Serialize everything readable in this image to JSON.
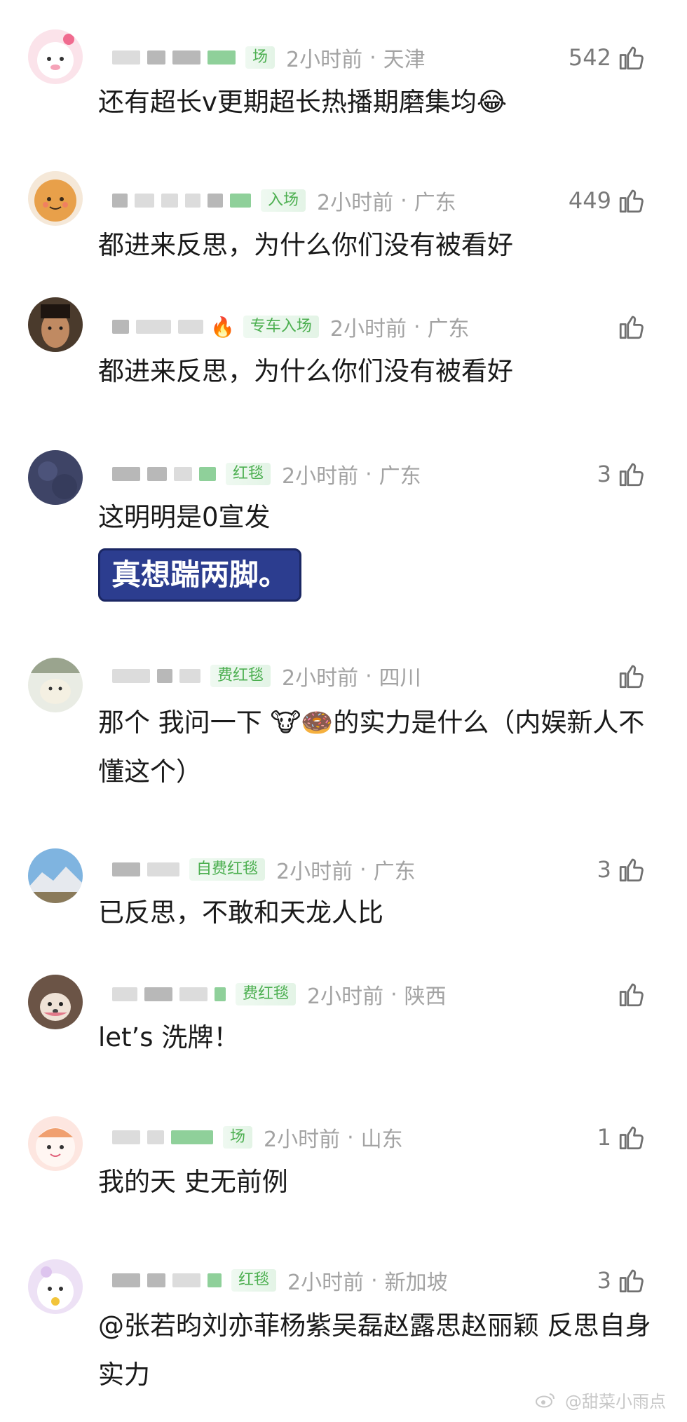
{
  "comments": [
    {
      "badge": "场",
      "time": "2小时前",
      "location": "天津",
      "likes": "542",
      "text": "还有超长v更期超长热播期磨集均😂"
    },
    {
      "badge": "入场",
      "time": "2小时前",
      "location": "广东",
      "likes": "449",
      "text": "都进来反思，为什么你们没有被看好"
    },
    {
      "badge": "专车入场",
      "time": "2小时前",
      "location": "广东",
      "likes": "",
      "text": "都进来反思，为什么你们没有被看好"
    },
    {
      "badge": "红毯",
      "time": "2小时前",
      "location": "广东",
      "likes": "3",
      "text": "这明明是0宣发",
      "sticker": "真想踹两脚。"
    },
    {
      "badge": "费红毯",
      "time": "2小时前",
      "location": "四川",
      "likes": "",
      "text": "那个 我问一下 🐮🍩的实力是什么（内娱新人不懂这个）"
    },
    {
      "badge": "自费红毯",
      "time": "2小时前",
      "location": "广东",
      "likes": "3",
      "text": "已反思，不敢和天龙人比"
    },
    {
      "badge": "费红毯",
      "time": "2小时前",
      "location": "陕西",
      "likes": "",
      "text": "let’s 洗牌！"
    },
    {
      "badge": "场",
      "time": "2小时前",
      "location": "山东",
      "likes": "1",
      "text": "我的天 史无前例"
    },
    {
      "badge": "红毯",
      "time": "2小时前",
      "location": "新加坡",
      "likes": "3",
      "text": "@张若昀刘亦菲杨紫吴磊赵露思赵丽颖 反思自身实力"
    }
  ],
  "separator": "·",
  "watermark": "@甜菜小雨点",
  "icons": {
    "like": "thumbs-up-icon",
    "fire": "fire-icon",
    "weibo": "weibo-logo-icon"
  },
  "colors": {
    "badge_text": "#4caf50",
    "meta": "#a3a3a3",
    "text": "#1a1a1a",
    "sticker_bg": "#2c3d8f"
  }
}
